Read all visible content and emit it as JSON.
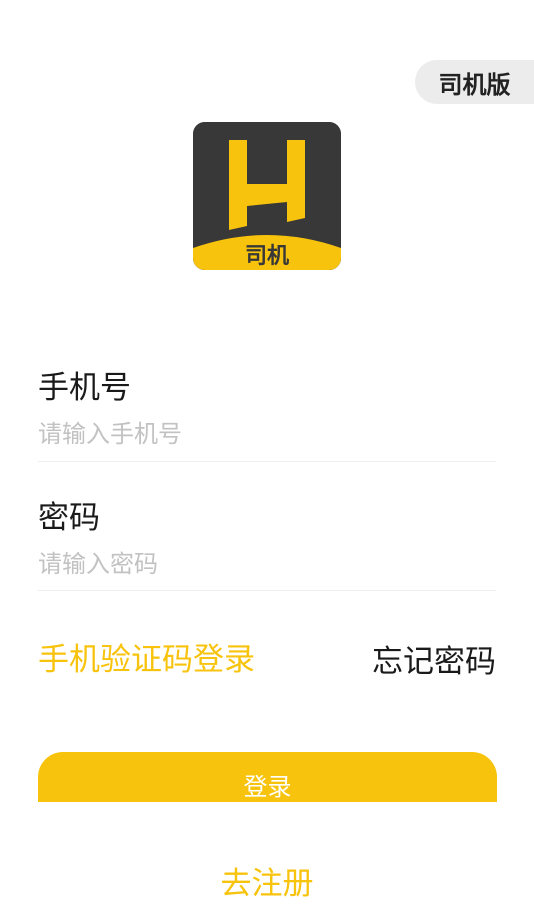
{
  "badge": {
    "label": "司机版"
  },
  "logo": {
    "caption": "司机",
    "letter_icon": "h-letter-icon"
  },
  "phone": {
    "label": "手机号",
    "placeholder": "请输入手机号",
    "value": ""
  },
  "password": {
    "label": "密码",
    "placeholder": "请输入密码",
    "value": ""
  },
  "links": {
    "sms_login": "手机验证码登录",
    "forgot_password": "忘记密码",
    "register": "去注册"
  },
  "login_button": {
    "label": "登录"
  },
  "colors": {
    "accent": "#f8c30c",
    "logo_bg": "#383838",
    "badge_bg": "#ececec"
  }
}
